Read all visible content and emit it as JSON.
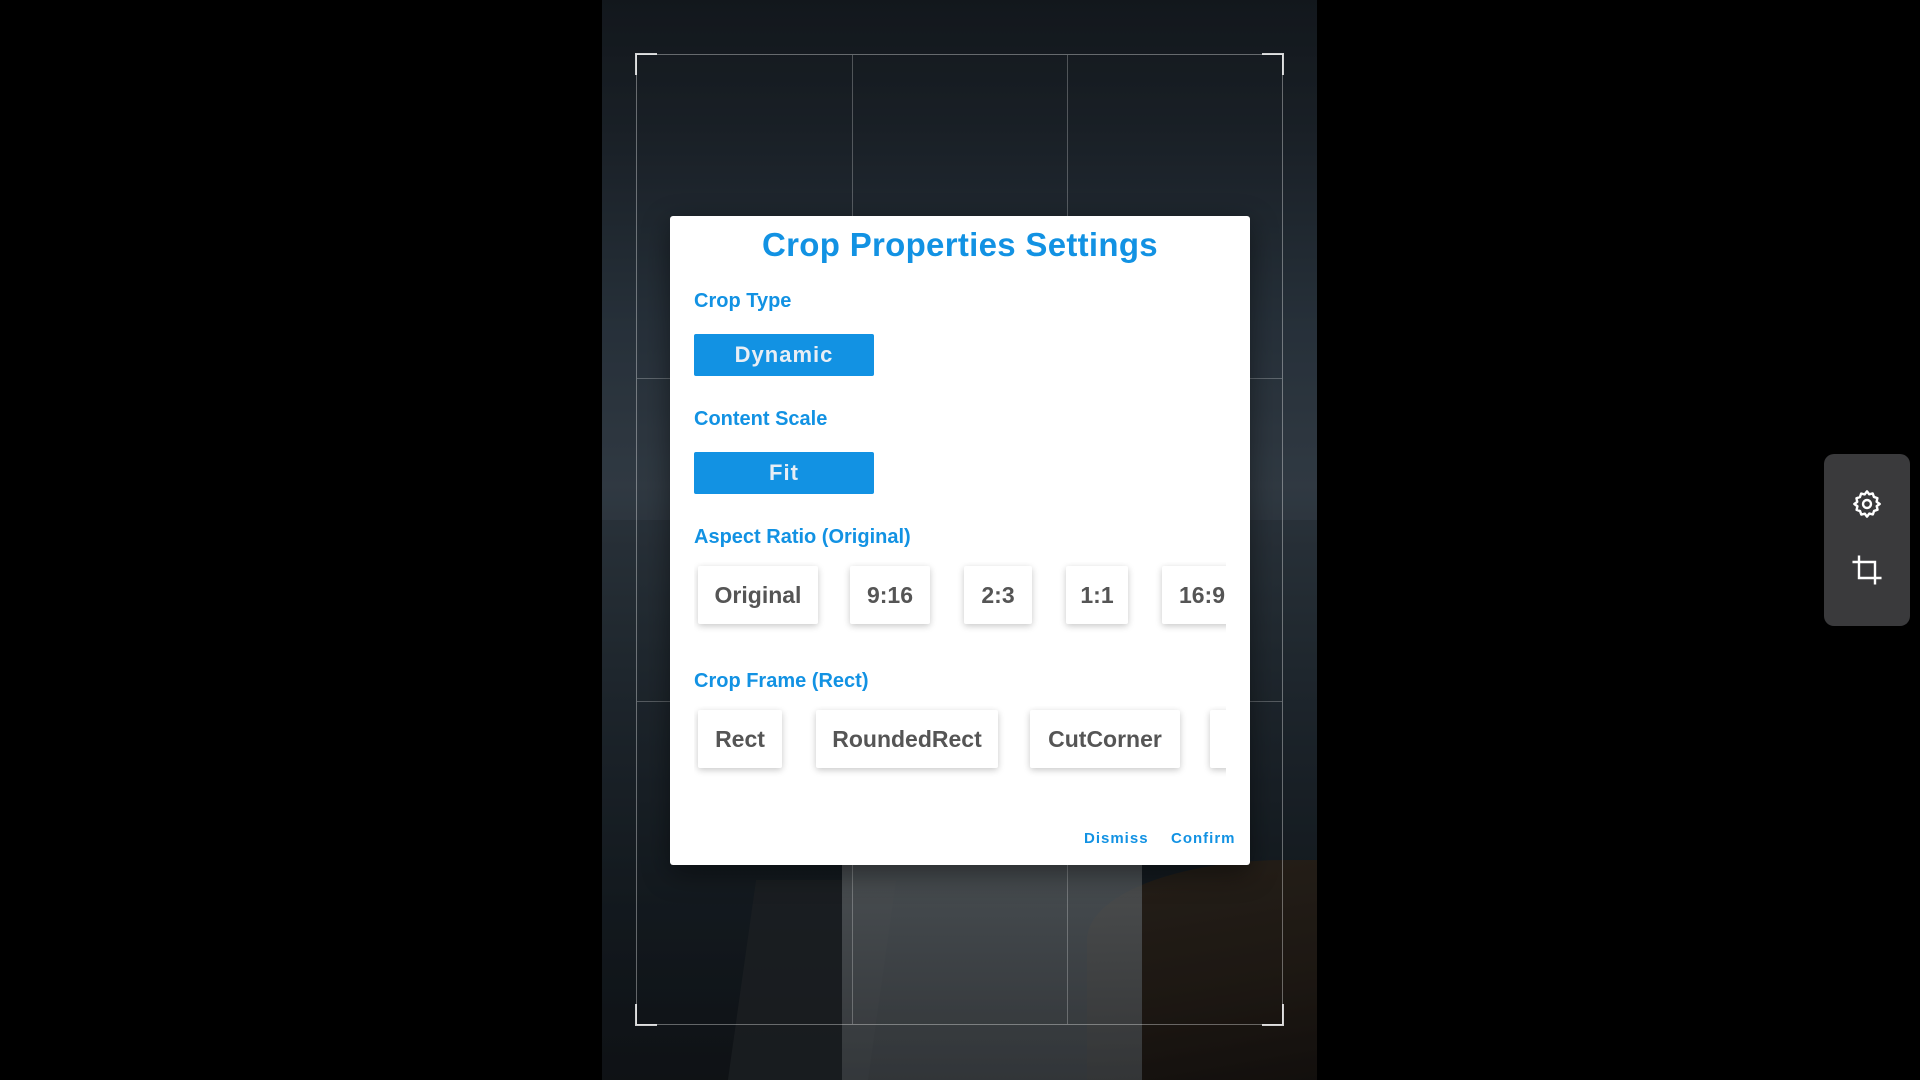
{
  "dialog": {
    "title": "Crop Properties Settings",
    "crop_type": {
      "label": "Crop Type",
      "value": "Dynamic"
    },
    "content_scale": {
      "label": "Content Scale",
      "value": "Fit"
    },
    "aspect_ratio": {
      "label": "Aspect Ratio (Original)",
      "options": [
        "Original",
        "9:16",
        "2:3",
        "1:1",
        "16:9"
      ]
    },
    "crop_frame": {
      "label": "Crop Frame (Rect)",
      "options": [
        "Rect",
        "RoundedRect",
        "CutCorner",
        ""
      ]
    },
    "actions": {
      "dismiss": "Dismiss",
      "confirm": "Confirm"
    }
  },
  "tools": {
    "settings_icon": "gear-icon",
    "crop_icon": "crop-icon"
  },
  "colors": {
    "accent": "#1292e3",
    "panel": "#3a3a3c",
    "chip_text": "#555555"
  }
}
